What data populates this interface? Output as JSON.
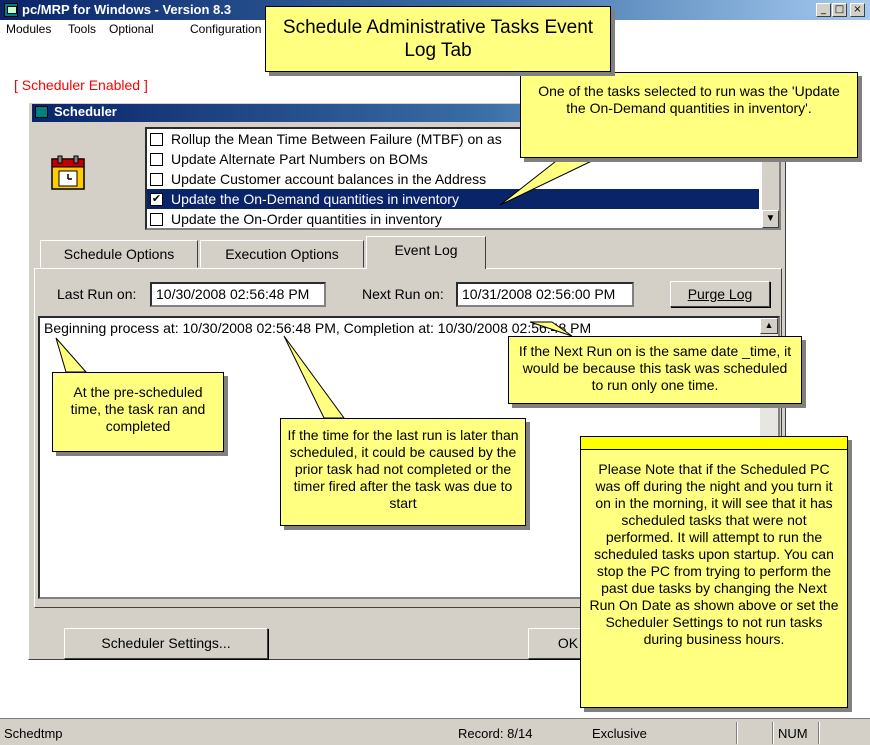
{
  "app": {
    "title": "pc/MRP for Windows - Version 8.3",
    "menus": [
      "Modules",
      "Tools",
      "Optional",
      "Configuration"
    ],
    "window_buttons": [
      "_",
      "□",
      "×"
    ]
  },
  "scheduler_status": "[ Scheduler Enabled ]",
  "scheduler": {
    "title": "Scheduler",
    "tasks": [
      {
        "label": "Rollup the Mean Time Between Failure (MTBF) on as",
        "checked": false,
        "selected": false
      },
      {
        "label": "Update Alternate Part Numbers on BOMs",
        "checked": false,
        "selected": false
      },
      {
        "label": "Update Customer account balances in the Address",
        "checked": false,
        "selected": false
      },
      {
        "label": "Update the On-Demand quantities in inventory",
        "checked": true,
        "selected": true
      },
      {
        "label": "Update the On-Order quantities in inventory",
        "checked": false,
        "selected": false
      }
    ],
    "check_mark": "✔",
    "tabs": [
      {
        "label": "Schedule Options",
        "active": false
      },
      {
        "label": "Execution Options",
        "active": false
      },
      {
        "label": "Event Log",
        "active": true
      }
    ],
    "last_run_label": "Last Run on:",
    "last_run_value": "10/30/2008 02:56:48 PM",
    "next_run_label": "Next Run on:",
    "next_run_value": "10/31/2008 02:56:00 PM",
    "purge_button": "Purge Log",
    "log_line": "Beginning process at: 10/30/2008 02:56:48 PM,  Completion at: 10/30/2008 02:56:48 PM",
    "settings_button": "Scheduler Settings...",
    "ok_button": "OK"
  },
  "status_bar": {
    "left": "Schedtmp",
    "record": "Record: 8/14",
    "mode": "Exclusive",
    "num": "NUM"
  },
  "callouts": {
    "title": "Schedule Administrative Tasks Event Log Tab",
    "task_selected": "One of the tasks selected to run was the 'Update the On-Demand quantities in inventory'.",
    "next_run": "If the Next Run on is the same date _time, it would be because this task was scheduled to run only one time.",
    "pre_scheduled": "At the pre-scheduled time, the task ran and completed",
    "last_run_later": "If the time for the last run is later than scheduled, it could be caused by the prior task had not completed or the timer fired after the task was due to start",
    "note": "Please Note that if the Scheduled PC was off during the night and you turn it on in the morning, it will see that it has scheduled tasks that were not performed. It  will attempt to run the scheduled tasks upon startup.   You can stop the PC from trying to perform the past due tasks by changing the Next Run On Date as shown above or set the Scheduler Settings to not run tasks during business hours."
  },
  "colors": {
    "callout_fill": "#ffff80",
    "titlebar": "#0a246a",
    "selection": "#0a246a",
    "status_red": "#ff0000",
    "dialog_face": "#d4d0c8"
  }
}
